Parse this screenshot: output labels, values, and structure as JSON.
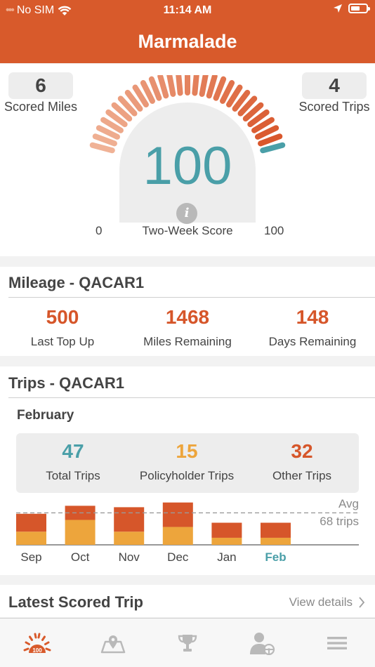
{
  "status_bar": {
    "carrier": "No SIM",
    "time": "11:14 AM"
  },
  "header": {
    "title": "Marmalade"
  },
  "score": {
    "scored_miles_value": "6",
    "scored_miles_label": "Scored Miles",
    "scored_trips_value": "4",
    "scored_trips_label": "Scored Trips",
    "value": "100",
    "label": "Two-Week Score",
    "gauge_min": "0",
    "gauge_max": "100",
    "gauge_fraction": 1.0
  },
  "mileage": {
    "title": "Mileage - QACAR1",
    "items": [
      {
        "value": "500",
        "label": "Last Top Up"
      },
      {
        "value": "1468",
        "label": "Miles Remaining"
      },
      {
        "value": "148",
        "label": "Days Remaining"
      }
    ]
  },
  "trips": {
    "title": "Trips - QACAR1",
    "month": "February",
    "stats": [
      {
        "value": "47",
        "label": "Total Trips",
        "color": "#4a9fa8"
      },
      {
        "value": "15",
        "label": "Policyholder Trips",
        "color": "#eda53c"
      },
      {
        "value": "32",
        "label": "Other Trips",
        "color": "#d6562a"
      }
    ],
    "avg_label_1": "Avg",
    "avg_label_2": "68 trips"
  },
  "chart_data": {
    "type": "bar",
    "stacked": true,
    "categories": [
      "Sep",
      "Oct",
      "Nov",
      "Dec",
      "Jan",
      "Feb"
    ],
    "series": [
      {
        "name": "Policyholder Trips",
        "color": "#eda53c",
        "values": [
          28,
          53,
          28,
          38,
          15,
          15
        ]
      },
      {
        "name": "Other Trips",
        "color": "#d6562a",
        "values": [
          38,
          30,
          52,
          52,
          32,
          32
        ]
      }
    ],
    "average": 68,
    "ymax": 90,
    "highlight": "Feb",
    "highlight_color": "#4a9fa8"
  },
  "latest": {
    "title": "Latest Scored Trip",
    "link": "View details"
  },
  "tabbar": {
    "tabs": [
      {
        "icon": "score-gauge-icon",
        "active": true
      },
      {
        "icon": "map-icon",
        "active": false
      },
      {
        "icon": "trophy-icon",
        "active": false
      },
      {
        "icon": "driver-icon",
        "active": false
      },
      {
        "icon": "menu-icon",
        "active": false
      }
    ]
  }
}
